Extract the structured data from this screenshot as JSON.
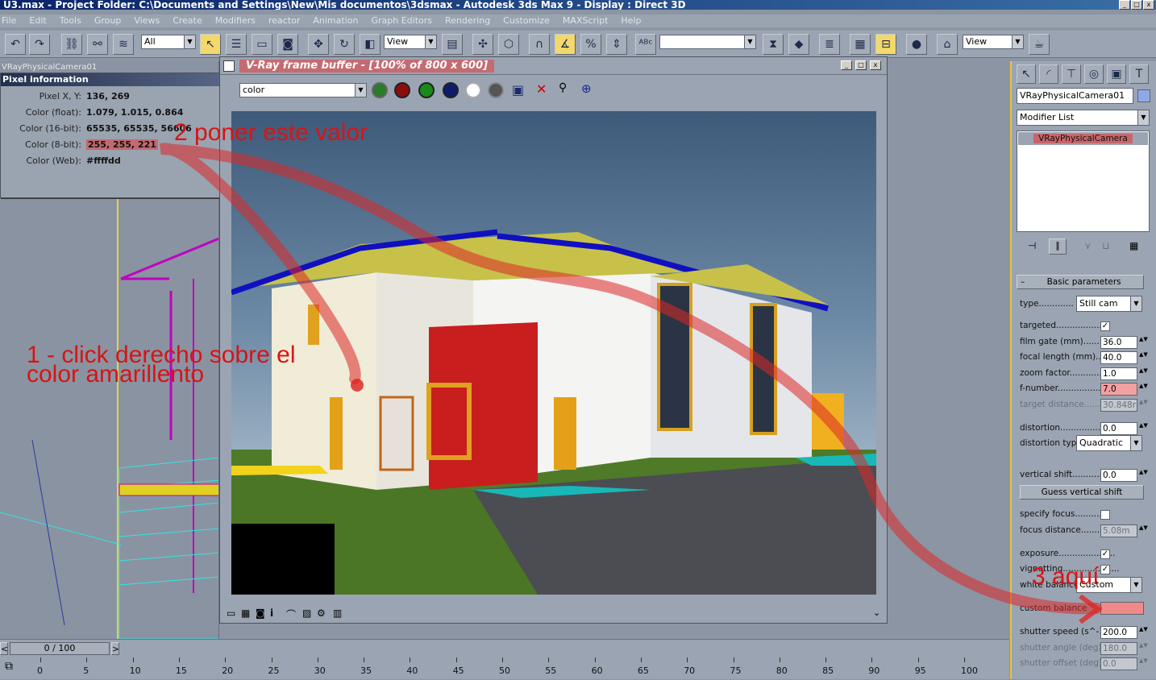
{
  "app": {
    "title": "U3.max      - Project Folder: C:\\Documents and Settings\\New\\Mis documentos\\3dsmax      - Autodesk 3ds Max 9      - Display : Direct 3D"
  },
  "menu": [
    "File",
    "Edit",
    "Tools",
    "Group",
    "Views",
    "Create",
    "Modifiers",
    "reactor",
    "Animation",
    "Graph Editors",
    "Rendering",
    "Customize",
    "MAXScript",
    "Help"
  ],
  "toolbar": {
    "selection_filter": "All",
    "ref_coord": "View",
    "named_selection": "",
    "view_dropdown": "View"
  },
  "viewport": {
    "label": "VRayPhysicalCamera01"
  },
  "pixel_info": {
    "title": "Pixel information",
    "rows": [
      {
        "label": "Pixel X, Y:",
        "value": "136, 269"
      },
      {
        "label": "Color (float):",
        "value": "1.079, 1.015, 0.864"
      },
      {
        "label": "Color (16-bit):",
        "value": "65535, 65535, 56606"
      },
      {
        "label": "Color (8-bit):",
        "value": "255, 255, 221"
      },
      {
        "label": "Color (Web):",
        "value": "#ffffdd"
      }
    ]
  },
  "frame_buffer": {
    "title": "V-Ray frame buffer - [100% of 800 x 600]",
    "channel": "color"
  },
  "command_panel": {
    "object_name": "VRayPhysicalCamera01",
    "modifier_list": "Modifier List",
    "stack_item": "VRayPhysicalCamera",
    "rollout_title": "Basic parameters",
    "params": {
      "type_label": "type.............",
      "type_value": "Still cam",
      "targeted_label": "targeted...................",
      "film_gate_label": "film gate (mm)..........",
      "film_gate_value": "36.0",
      "focal_length_label": "focal length (mm).....",
      "focal_length_value": "40.0",
      "zoom_factor_label": "zoom factor.............",
      "zoom_factor_value": "1.0",
      "f_number_label": "f-number.....................",
      "f_number_value": "7.0",
      "target_distance_label": "target distance..........",
      "target_distance_value": "30.848r",
      "distortion_label": "distortion....................",
      "distortion_value": "0.0",
      "distortion_type_label": "distortion type.",
      "distortion_type_value": "Quadratic",
      "vertical_shift_label": "vertical shift................",
      "vertical_shift_value": "0.0",
      "guess_vertical_shift": "Guess vertical shift",
      "specify_focus_label": "specify focus.............",
      "focus_distance_label": "focus distance...........",
      "focus_distance_value": "5.08m",
      "exposure_label": "exposure.....................",
      "vignetting_label": "vignetting.....................",
      "white_balance_label": "white balance",
      "white_balance_value": "Custom",
      "custom_balance_label": "custom balance",
      "shutter_speed_label": "shutter speed (s^-1)..",
      "shutter_speed_value": "200.0",
      "shutter_angle_label": "shutter angle (deg)...",
      "shutter_angle_value": "180.0",
      "shutter_offset_label": "shutter offset (deg)..",
      "shutter_offset_value": "0.0"
    }
  },
  "timeline": {
    "frame": "0 / 100",
    "ticks": [
      "0",
      "5",
      "10",
      "15",
      "20",
      "25",
      "30",
      "35",
      "40",
      "45",
      "50",
      "55",
      "60",
      "65",
      "70",
      "75",
      "80",
      "85",
      "90",
      "95",
      "100"
    ]
  },
  "annotations": {
    "step1_line1": "1 - click  derecho sobre el",
    "step1_line2": "color amarillento",
    "step2": "2  poner este valor",
    "step3": "3 aquí"
  },
  "colors": {
    "accent_yellow": "#e7c635",
    "annotation_red": "#d81414",
    "custom_balance_swatch": "#f08a8a",
    "ui_gray": "#9ba4b2"
  }
}
